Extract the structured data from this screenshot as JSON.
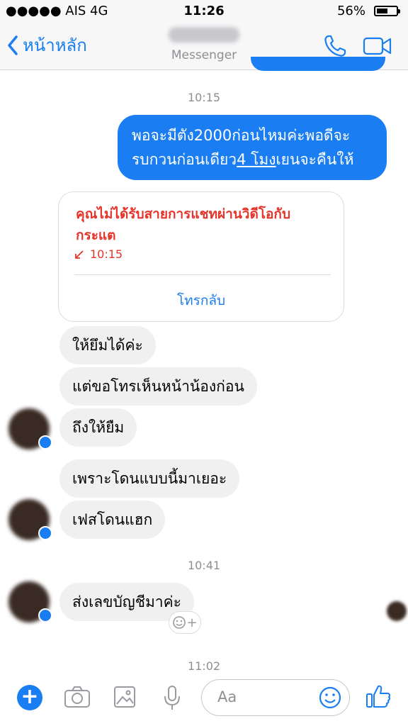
{
  "status_bar": {
    "carrier": "●●●●● AIS  4G",
    "time": "11:26",
    "battery": "56%",
    "battery_level": 0.56
  },
  "nav": {
    "back_label": "หน้าหลัก",
    "subtitle": "Messenger"
  },
  "messages": {
    "time1": "10:15",
    "outgoing_line1": "พอจะมีตัง2000ก่อนไหมค่ะพอดีจะ",
    "outgoing_line2_a": "รบกวนก่อนเดียว",
    "outgoing_line2_link": "4 โมง",
    "outgoing_line2_b": "เยนจะคืนให้",
    "missed_call_title": "คุณไม่ได้รับสายการแชทผ่านวิดีโอกับกระแต",
    "missed_call_time": "10:15",
    "callback_label": "โทรกลับ",
    "in1": "ให้ยึมได้ค่ะ",
    "in2": "แต่ขอโทรเห็นหน้าน้องก่อน",
    "in3": "ถึงให้ยืม",
    "in4": "เพราะโดนแบบนี้มาเยอะ",
    "in5": "เฟสโดนแฮก",
    "time2": "10:41",
    "in6": "ส่งเลขบัญชีมาค่ะ",
    "reaction_plus": "+",
    "time3": "11:02"
  },
  "composer": {
    "plus": "+",
    "placeholder": "Aa"
  },
  "colors": {
    "accent": "#1a7ef2",
    "missed": "#e5352b",
    "incoming_bubble": "#f1f0f0"
  }
}
